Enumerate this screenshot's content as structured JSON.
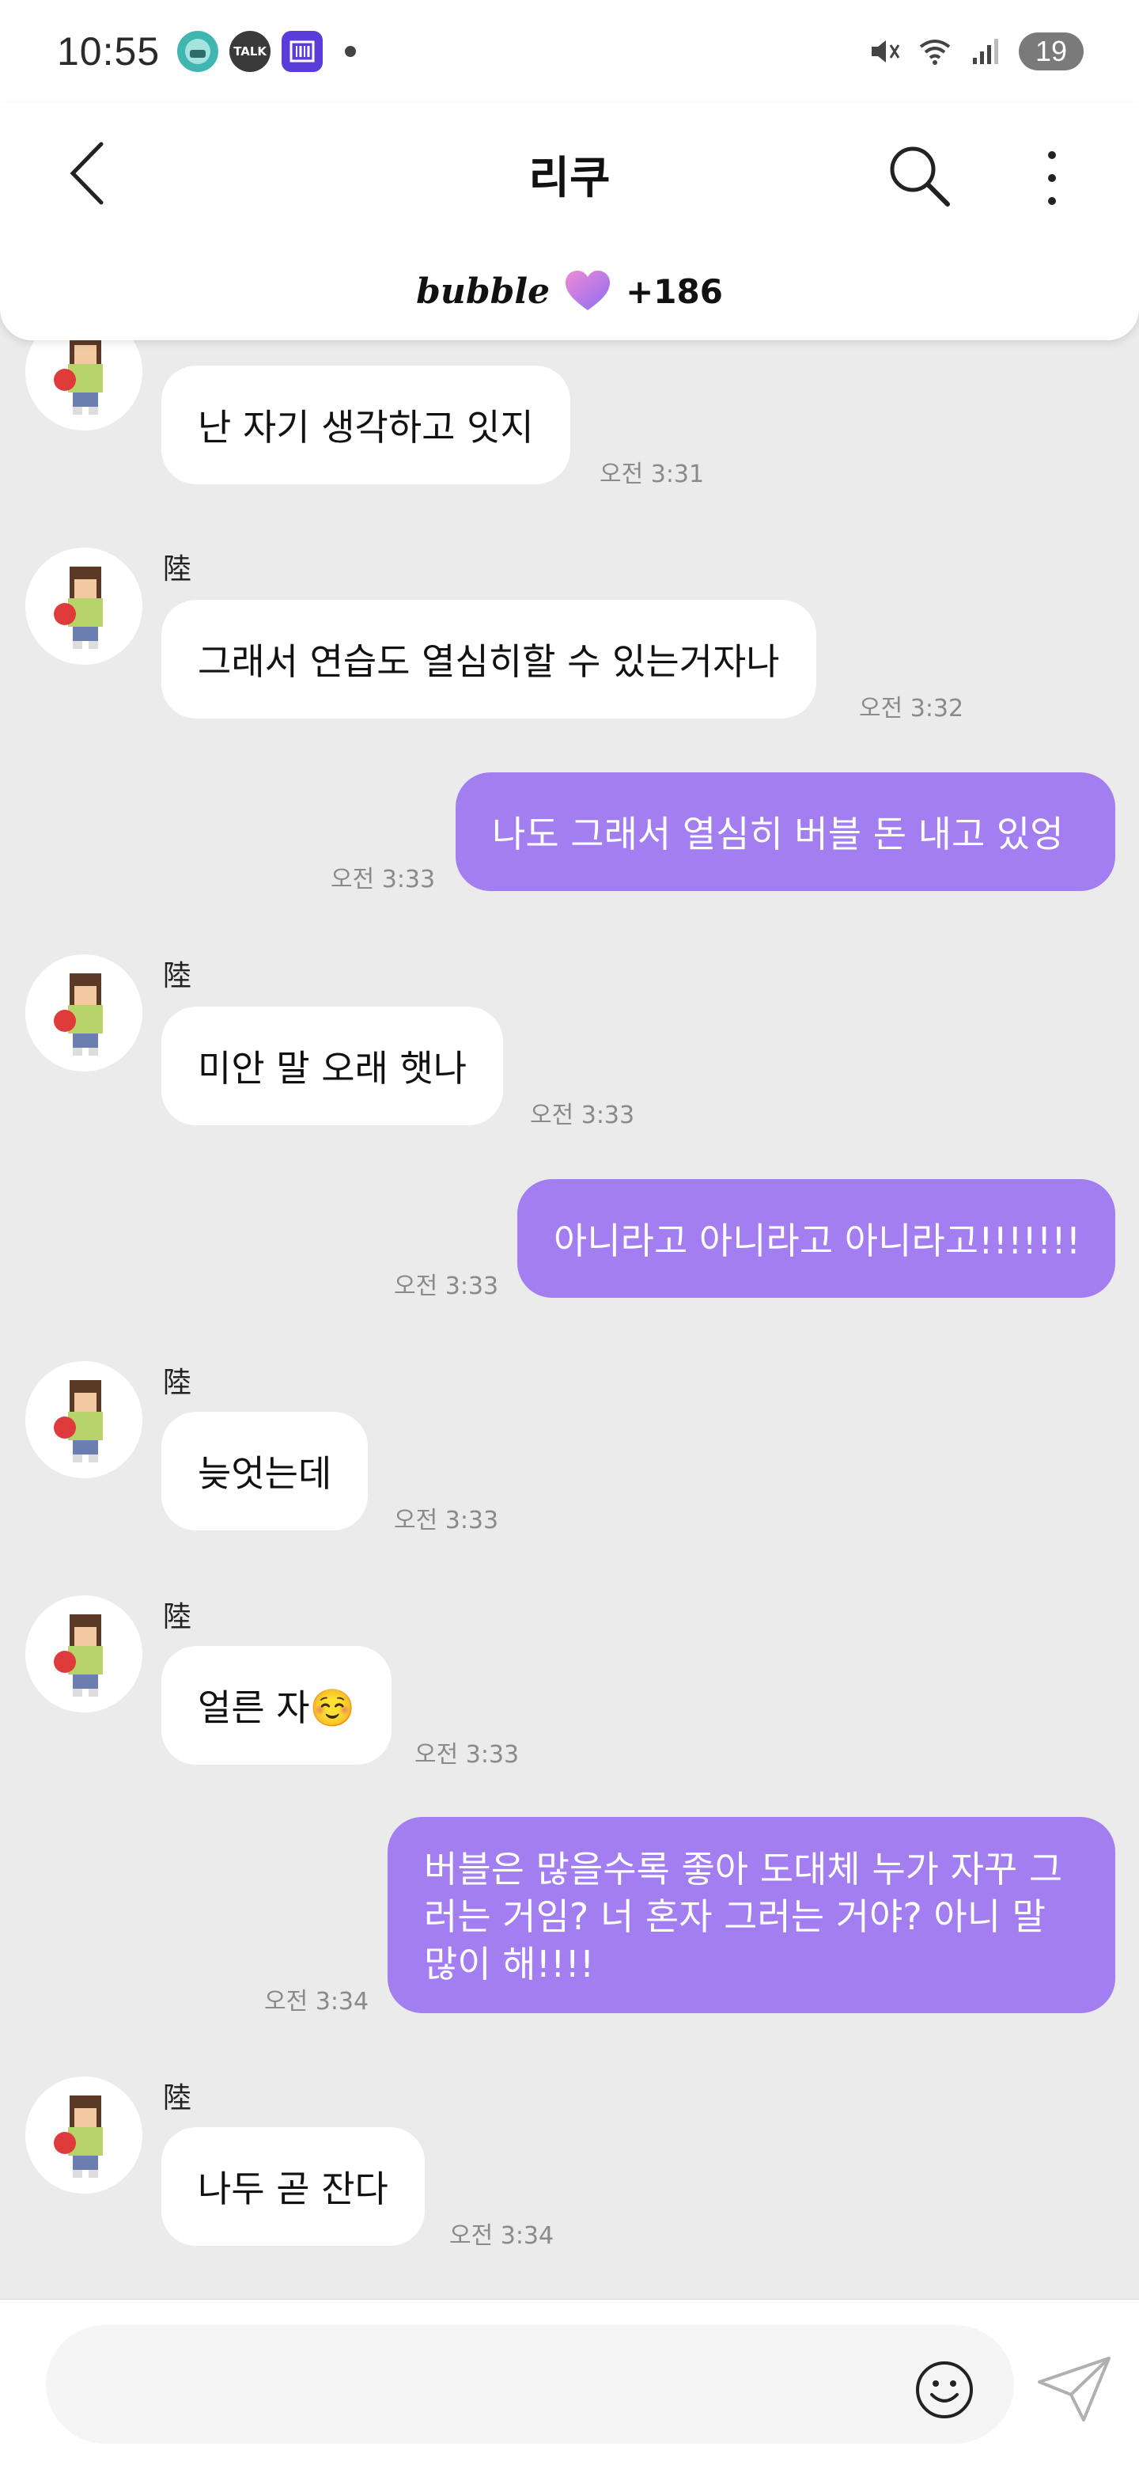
{
  "status_bar": {
    "time": "10:55",
    "app_icons": [
      "app-icon",
      "talk-icon",
      "scanner-icon"
    ],
    "talk_label": "TALK",
    "battery": "19"
  },
  "header": {
    "title": "리쿠",
    "brand": "bubble",
    "heart_count": "+186"
  },
  "messages": [
    {
      "direction": "in",
      "sender": "",
      "text": "난 자기 생각하고 잇지",
      "time": "오전 3:31"
    },
    {
      "direction": "in",
      "sender": "陸",
      "text": "그래서 연습도 열심히할 수 있는거자나",
      "time": "오전 3:32"
    },
    {
      "direction": "out",
      "text": "나도 그래서 열심히 버블 돈 내고 있엉",
      "time": "오전 3:33"
    },
    {
      "direction": "in",
      "sender": "陸",
      "text": "미안 말 오래 햇나",
      "time": "오전 3:33"
    },
    {
      "direction": "out",
      "text": "아니라고 아니라고 아니라고!!!!!!!",
      "time": "오전 3:33"
    },
    {
      "direction": "in",
      "sender": "陸",
      "text": "늦엇는데",
      "time": "오전 3:33"
    },
    {
      "direction": "in",
      "sender": "陸",
      "text": "얼른 자☺️",
      "time": "오전 3:33"
    },
    {
      "direction": "out",
      "text": "버블은 많을수록 좋아 도대체 누가 자꾸 그러는 거임? 너 혼자 그러는 거야? 아니 말 많이 해!!!!",
      "time": "오전 3:34"
    },
    {
      "direction": "in",
      "sender": "陸",
      "text": "나두 곧 잔다",
      "time": "오전 3:34"
    }
  ],
  "input": {
    "placeholder": ""
  },
  "colors": {
    "background": "#ebebeb",
    "outgoing_bubble": "#a27ef0",
    "incoming_bubble": "#ffffff"
  }
}
